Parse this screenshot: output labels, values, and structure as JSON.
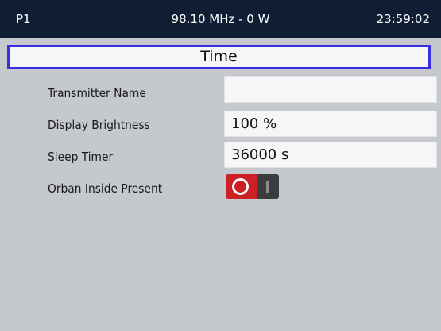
{
  "status_bar": {
    "preset": "P1",
    "frequency_power": "98.10 MHz - 0 W",
    "clock": "23:59:02"
  },
  "page": {
    "title": "Time"
  },
  "settings": {
    "transmitter_name": {
      "label": "Transmitter Name",
      "value": ""
    },
    "display_brightness": {
      "label": "Display Brightness",
      "value": "100 %"
    },
    "sleep_timer": {
      "label": "Sleep Timer",
      "value": "36000 s"
    },
    "orban_inside_present": {
      "label": "Orban Inside Present",
      "state": "on"
    }
  },
  "colors": {
    "status_bar_bg": "#0f1e33",
    "page_bg": "#c5c8cd",
    "title_border": "#3a2fe0",
    "toggle_on": "#cc2026",
    "toggle_off": "#3a3c3e"
  },
  "icons": {
    "toggle_on": "ring-icon",
    "toggle_off": "bar-icon"
  }
}
